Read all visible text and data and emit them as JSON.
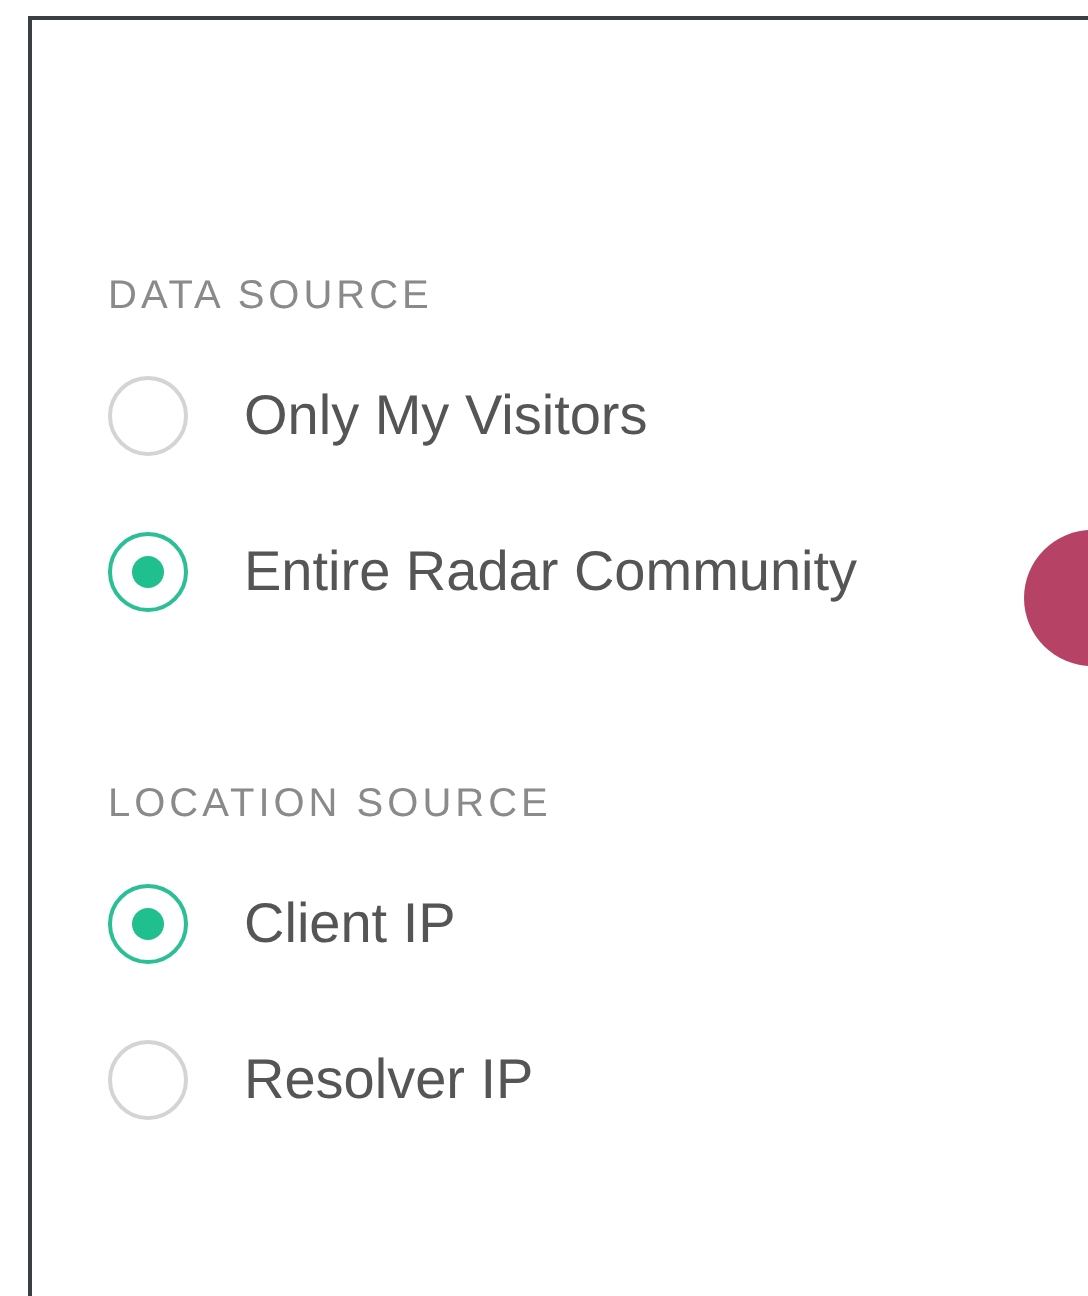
{
  "sections": [
    {
      "heading": "DATA SOURCE",
      "options": [
        {
          "label": "Only My Visitors",
          "selected": false
        },
        {
          "label": "Entire Radar Community",
          "selected": true
        }
      ]
    },
    {
      "heading": "LOCATION SOURCE",
      "options": [
        {
          "label": "Client IP",
          "selected": true
        },
        {
          "label": "Resolver IP",
          "selected": false
        }
      ]
    }
  ]
}
